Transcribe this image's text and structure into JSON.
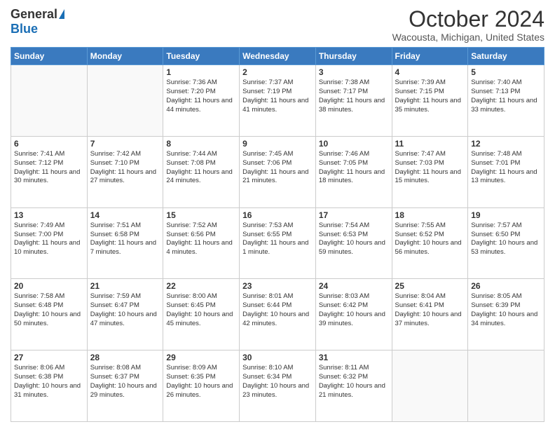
{
  "header": {
    "logo_general": "General",
    "logo_blue": "Blue",
    "title": "October 2024",
    "subtitle": "Wacousta, Michigan, United States"
  },
  "days_of_week": [
    "Sunday",
    "Monday",
    "Tuesday",
    "Wednesday",
    "Thursday",
    "Friday",
    "Saturday"
  ],
  "weeks": [
    [
      {
        "day": "",
        "info": ""
      },
      {
        "day": "",
        "info": ""
      },
      {
        "day": "1",
        "info": "Sunrise: 7:36 AM\nSunset: 7:20 PM\nDaylight: 11 hours and 44 minutes."
      },
      {
        "day": "2",
        "info": "Sunrise: 7:37 AM\nSunset: 7:19 PM\nDaylight: 11 hours and 41 minutes."
      },
      {
        "day": "3",
        "info": "Sunrise: 7:38 AM\nSunset: 7:17 PM\nDaylight: 11 hours and 38 minutes."
      },
      {
        "day": "4",
        "info": "Sunrise: 7:39 AM\nSunset: 7:15 PM\nDaylight: 11 hours and 35 minutes."
      },
      {
        "day": "5",
        "info": "Sunrise: 7:40 AM\nSunset: 7:13 PM\nDaylight: 11 hours and 33 minutes."
      }
    ],
    [
      {
        "day": "6",
        "info": "Sunrise: 7:41 AM\nSunset: 7:12 PM\nDaylight: 11 hours and 30 minutes."
      },
      {
        "day": "7",
        "info": "Sunrise: 7:42 AM\nSunset: 7:10 PM\nDaylight: 11 hours and 27 minutes."
      },
      {
        "day": "8",
        "info": "Sunrise: 7:44 AM\nSunset: 7:08 PM\nDaylight: 11 hours and 24 minutes."
      },
      {
        "day": "9",
        "info": "Sunrise: 7:45 AM\nSunset: 7:06 PM\nDaylight: 11 hours and 21 minutes."
      },
      {
        "day": "10",
        "info": "Sunrise: 7:46 AM\nSunset: 7:05 PM\nDaylight: 11 hours and 18 minutes."
      },
      {
        "day": "11",
        "info": "Sunrise: 7:47 AM\nSunset: 7:03 PM\nDaylight: 11 hours and 15 minutes."
      },
      {
        "day": "12",
        "info": "Sunrise: 7:48 AM\nSunset: 7:01 PM\nDaylight: 11 hours and 13 minutes."
      }
    ],
    [
      {
        "day": "13",
        "info": "Sunrise: 7:49 AM\nSunset: 7:00 PM\nDaylight: 11 hours and 10 minutes."
      },
      {
        "day": "14",
        "info": "Sunrise: 7:51 AM\nSunset: 6:58 PM\nDaylight: 11 hours and 7 minutes."
      },
      {
        "day": "15",
        "info": "Sunrise: 7:52 AM\nSunset: 6:56 PM\nDaylight: 11 hours and 4 minutes."
      },
      {
        "day": "16",
        "info": "Sunrise: 7:53 AM\nSunset: 6:55 PM\nDaylight: 11 hours and 1 minute."
      },
      {
        "day": "17",
        "info": "Sunrise: 7:54 AM\nSunset: 6:53 PM\nDaylight: 10 hours and 59 minutes."
      },
      {
        "day": "18",
        "info": "Sunrise: 7:55 AM\nSunset: 6:52 PM\nDaylight: 10 hours and 56 minutes."
      },
      {
        "day": "19",
        "info": "Sunrise: 7:57 AM\nSunset: 6:50 PM\nDaylight: 10 hours and 53 minutes."
      }
    ],
    [
      {
        "day": "20",
        "info": "Sunrise: 7:58 AM\nSunset: 6:48 PM\nDaylight: 10 hours and 50 minutes."
      },
      {
        "day": "21",
        "info": "Sunrise: 7:59 AM\nSunset: 6:47 PM\nDaylight: 10 hours and 47 minutes."
      },
      {
        "day": "22",
        "info": "Sunrise: 8:00 AM\nSunset: 6:45 PM\nDaylight: 10 hours and 45 minutes."
      },
      {
        "day": "23",
        "info": "Sunrise: 8:01 AM\nSunset: 6:44 PM\nDaylight: 10 hours and 42 minutes."
      },
      {
        "day": "24",
        "info": "Sunrise: 8:03 AM\nSunset: 6:42 PM\nDaylight: 10 hours and 39 minutes."
      },
      {
        "day": "25",
        "info": "Sunrise: 8:04 AM\nSunset: 6:41 PM\nDaylight: 10 hours and 37 minutes."
      },
      {
        "day": "26",
        "info": "Sunrise: 8:05 AM\nSunset: 6:39 PM\nDaylight: 10 hours and 34 minutes."
      }
    ],
    [
      {
        "day": "27",
        "info": "Sunrise: 8:06 AM\nSunset: 6:38 PM\nDaylight: 10 hours and 31 minutes."
      },
      {
        "day": "28",
        "info": "Sunrise: 8:08 AM\nSunset: 6:37 PM\nDaylight: 10 hours and 29 minutes."
      },
      {
        "day": "29",
        "info": "Sunrise: 8:09 AM\nSunset: 6:35 PM\nDaylight: 10 hours and 26 minutes."
      },
      {
        "day": "30",
        "info": "Sunrise: 8:10 AM\nSunset: 6:34 PM\nDaylight: 10 hours and 23 minutes."
      },
      {
        "day": "31",
        "info": "Sunrise: 8:11 AM\nSunset: 6:32 PM\nDaylight: 10 hours and 21 minutes."
      },
      {
        "day": "",
        "info": ""
      },
      {
        "day": "",
        "info": ""
      }
    ]
  ]
}
